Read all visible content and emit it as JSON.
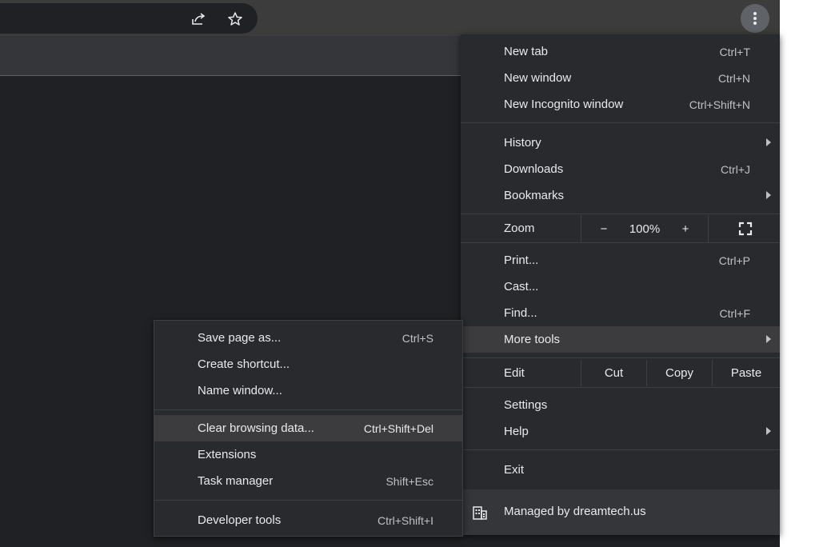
{
  "menu": {
    "items": {
      "new_tab": {
        "label": "New tab",
        "shortcut": "Ctrl+T"
      },
      "new_window": {
        "label": "New window",
        "shortcut": "Ctrl+N"
      },
      "new_incognito": {
        "label": "New Incognito window",
        "shortcut": "Ctrl+Shift+N"
      },
      "history": {
        "label": "History"
      },
      "downloads": {
        "label": "Downloads",
        "shortcut": "Ctrl+J"
      },
      "bookmarks": {
        "label": "Bookmarks"
      },
      "print": {
        "label": "Print...",
        "shortcut": "Ctrl+P"
      },
      "cast": {
        "label": "Cast..."
      },
      "find": {
        "label": "Find...",
        "shortcut": "Ctrl+F"
      },
      "more_tools": {
        "label": "More tools"
      },
      "settings": {
        "label": "Settings"
      },
      "help": {
        "label": "Help"
      },
      "exit": {
        "label": "Exit"
      }
    },
    "zoom": {
      "label": "Zoom",
      "minus": "−",
      "value": "100%",
      "plus": "+"
    },
    "edit": {
      "label": "Edit",
      "cut": "Cut",
      "copy": "Copy",
      "paste": "Paste"
    },
    "managed": {
      "label": "Managed by dreamtech.us"
    }
  },
  "more_tools": {
    "items": {
      "save_page": {
        "label": "Save page as...",
        "shortcut": "Ctrl+S"
      },
      "create_shortcut": {
        "label": "Create shortcut..."
      },
      "name_window": {
        "label": "Name window..."
      },
      "clear_browsing": {
        "label": "Clear browsing data...",
        "shortcut": "Ctrl+Shift+Del"
      },
      "extensions": {
        "label": "Extensions"
      },
      "task_manager": {
        "label": "Task manager",
        "shortcut": "Shift+Esc"
      },
      "developer_tools": {
        "label": "Developer tools",
        "shortcut": "Ctrl+Shift+I"
      }
    }
  },
  "icons": {
    "share": "share-icon",
    "bookmark_star": "star-icon",
    "menu": "kebab-menu-icon",
    "fullscreen": "fullscreen-icon",
    "managed": "building-icon"
  },
  "colors": {
    "menu_bg": "#292a2d",
    "highlight": "#3c3c3f",
    "text": "#e8eaed",
    "toolbar": "#3c3c3c"
  }
}
